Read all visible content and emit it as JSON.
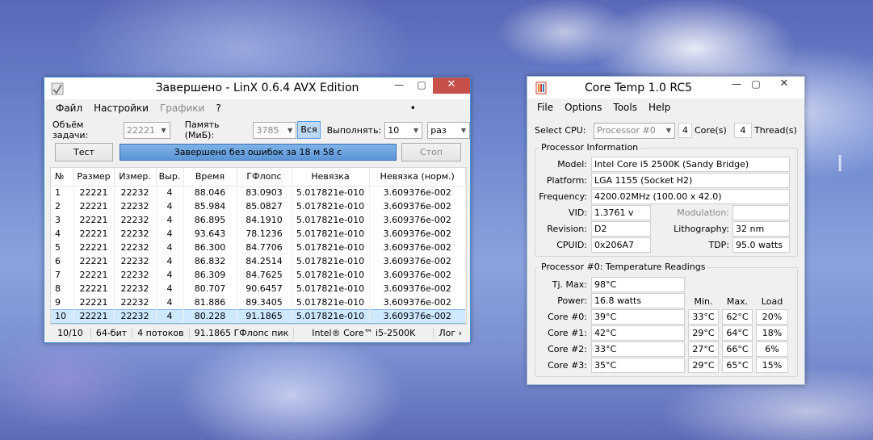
{
  "linx": {
    "title": "Завершено - LinX 0.6.4 AVX Edition",
    "menu": [
      "Файл",
      "Настройки",
      "Графики",
      "?"
    ],
    "problem_size_label": "Объём задачи:",
    "problem_size_value": "22221",
    "memory_label": "Память (МиБ):",
    "memory_value": "3785",
    "all_button": "Вся",
    "run_label": "Выполнять:",
    "run_value": "10",
    "run_unit": "раз",
    "test_button": "Тест",
    "progress_text": "Завершено без ошибок за 18 м 58 с",
    "stop_button": "Стоп",
    "columns": [
      "№",
      "Размер",
      "Измер.",
      "Выр.",
      "Время",
      "ГФлопс",
      "Невязка",
      "Невязка (норм.)"
    ],
    "rows": [
      [
        "1",
        "22221",
        "22232",
        "4",
        "88.046",
        "83.0903",
        "5.017821e-010",
        "3.609376e-002"
      ],
      [
        "2",
        "22221",
        "22232",
        "4",
        "85.984",
        "85.0827",
        "5.017821e-010",
        "3.609376e-002"
      ],
      [
        "3",
        "22221",
        "22232",
        "4",
        "86.895",
        "84.1910",
        "5.017821e-010",
        "3.609376e-002"
      ],
      [
        "4",
        "22221",
        "22232",
        "4",
        "93.643",
        "78.1236",
        "5.017821e-010",
        "3.609376e-002"
      ],
      [
        "5",
        "22221",
        "22232",
        "4",
        "86.300",
        "84.7706",
        "5.017821e-010",
        "3.609376e-002"
      ],
      [
        "6",
        "22221",
        "22232",
        "4",
        "86.832",
        "84.2514",
        "5.017821e-010",
        "3.609376e-002"
      ],
      [
        "7",
        "22221",
        "22232",
        "4",
        "86.309",
        "84.7625",
        "5.017821e-010",
        "3.609376e-002"
      ],
      [
        "8",
        "22221",
        "22232",
        "4",
        "80.707",
        "90.6457",
        "5.017821e-010",
        "3.609376e-002"
      ],
      [
        "9",
        "22221",
        "22232",
        "4",
        "81.886",
        "89.3405",
        "5.017821e-010",
        "3.609376e-002"
      ],
      [
        "10",
        "22221",
        "22232",
        "4",
        "80.228",
        "91.1865",
        "5.017821e-010",
        "3.609376e-002"
      ]
    ],
    "status": {
      "progress": "10/10",
      "bits": "64-бит",
      "threads": "4 потоков",
      "peak": "91.1865 ГФлопс пик",
      "cpu": "Intel® Core™ i5-2500K",
      "log": "Лог ›"
    }
  },
  "coretemp": {
    "title": "Core Temp 1.0 RC5",
    "menu": [
      "File",
      "Options",
      "Tools",
      "Help"
    ],
    "select_cpu_label": "Select CPU:",
    "select_cpu_value": "Processor #0",
    "cores_count": "4",
    "cores_label": "Core(s)",
    "threads_count": "4",
    "threads_label": "Thread(s)",
    "info_group": "Processor Information",
    "model_label": "Model:",
    "model_value": "Intel Core i5 2500K (Sandy Bridge)",
    "platform_label": "Platform:",
    "platform_value": "LGA 1155 (Socket H2)",
    "frequency_label": "Frequency:",
    "frequency_value": "4200.02MHz (100.00 x 42.0)",
    "vid_label": "VID:",
    "vid_value": "1.3761 v",
    "modulation_label": "Modulation:",
    "revision_label": "Revision:",
    "revision_value": "D2",
    "lithography_label": "Lithography:",
    "lithography_value": "32 nm",
    "cpuid_label": "CPUID:",
    "cpuid_value": "0x206A7",
    "tdp_label": "TDP:",
    "tdp_value": "95.0 watts",
    "temp_group": "Processor #0: Temperature Readings",
    "tjmax_label": "Tj. Max:",
    "tjmax_value": "98°C",
    "power_label": "Power:",
    "power_value": "16.8 watts",
    "col_min": "Min.",
    "col_max": "Max.",
    "col_load": "Load",
    "cores": [
      {
        "label": "Core #0:",
        "temp": "39°C",
        "min": "33°C",
        "max": "62°C",
        "load": "20%"
      },
      {
        "label": "Core #1:",
        "temp": "42°C",
        "min": "29°C",
        "max": "64°C",
        "load": "18%"
      },
      {
        "label": "Core #2:",
        "temp": "33°C",
        "min": "27°C",
        "max": "66°C",
        "load": "6%"
      },
      {
        "label": "Core #3:",
        "temp": "35°C",
        "min": "29°C",
        "max": "65°C",
        "load": "15%"
      }
    ]
  },
  "colors": {
    "close_button": "#c7504b",
    "progress_fill": "#6fa5e0",
    "selected_row": "#cde8ff"
  }
}
